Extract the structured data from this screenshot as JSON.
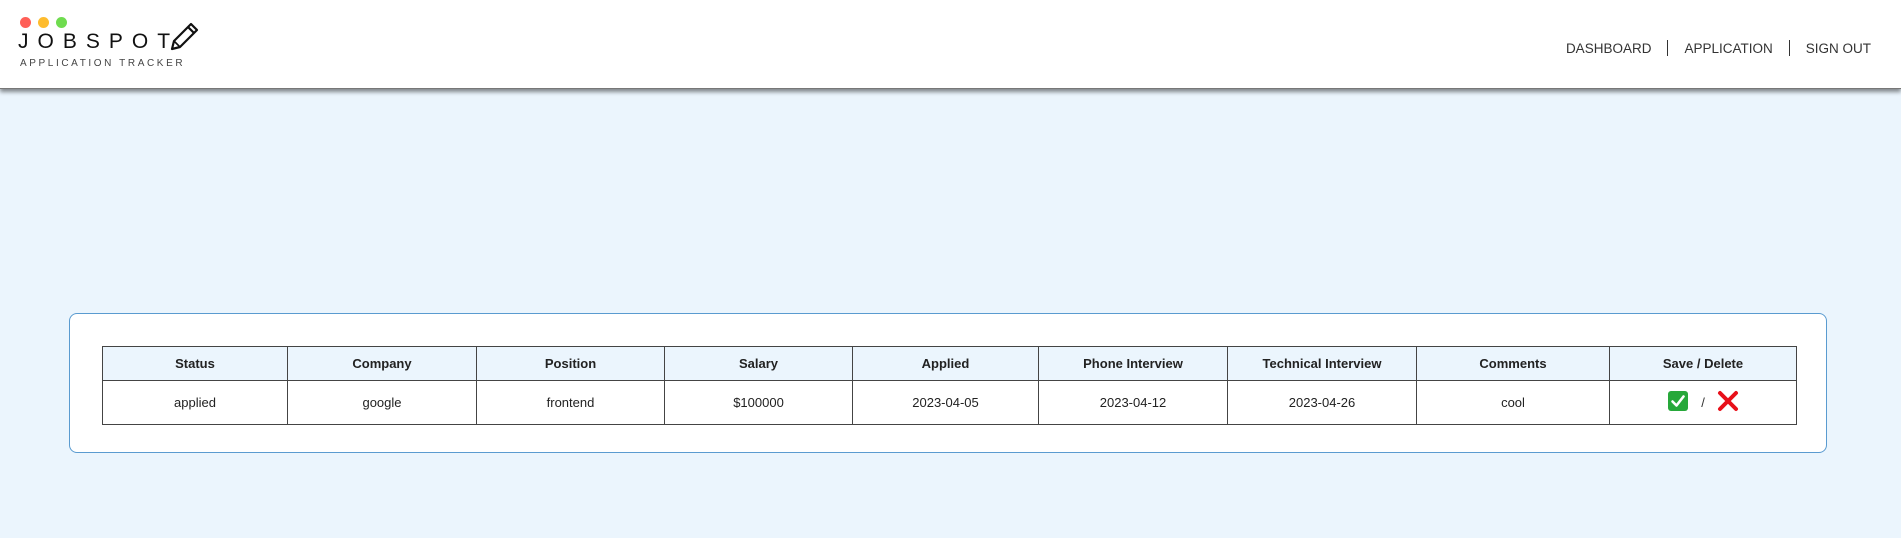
{
  "header": {
    "logo_text": "JOBSPOT",
    "logo_subtitle": "APPLICATION TRACKER",
    "nav": [
      {
        "label": "DASHBOARD"
      },
      {
        "label": "APPLICATION"
      },
      {
        "label": "SIGN OUT"
      }
    ]
  },
  "colors": {
    "page_background": "#ebf5fd",
    "card_border": "#5a9bd0",
    "save_green": "#27a83a",
    "delete_red": "#e8101a"
  },
  "table": {
    "columns": [
      "Status",
      "Company",
      "Position",
      "Salary",
      "Applied",
      "Phone Interview",
      "Technical Interview",
      "Comments",
      "Save / Delete"
    ],
    "rows": [
      {
        "status": "applied",
        "company": "google",
        "position": "frontend",
        "salary": "$100000",
        "applied": "2023-04-05",
        "phone_interview": "2023-04-12",
        "technical_interview": "2023-04-26",
        "comments": "cool",
        "action_separator": "/",
        "save_icon": "check-mark-icon",
        "delete_icon": "cross-mark-icon"
      }
    ]
  }
}
